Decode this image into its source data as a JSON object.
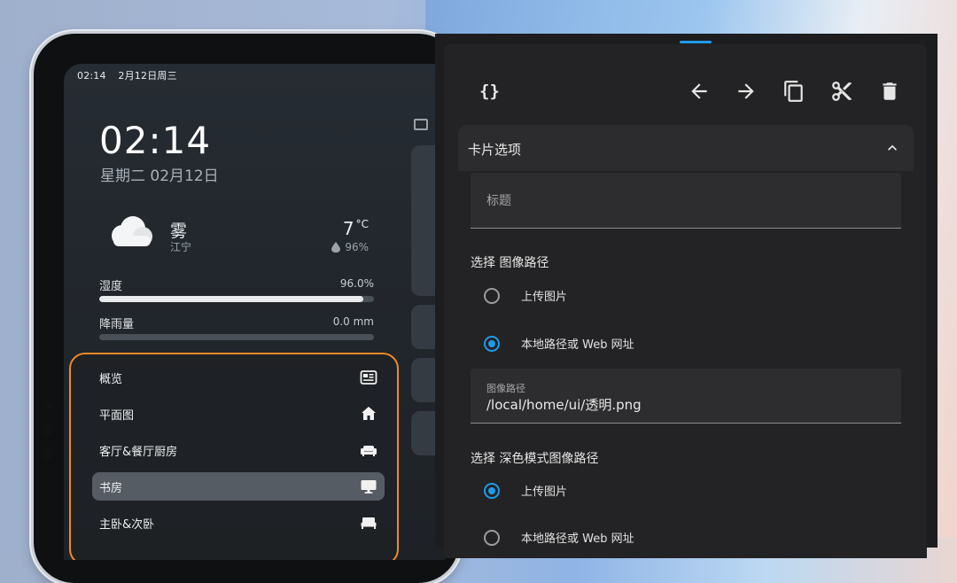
{
  "status_bar": {
    "time": "02:14",
    "date": "2月12日周三"
  },
  "clock": {
    "time": "02:14",
    "date": "星期二 02月12日"
  },
  "weather": {
    "condition": "雾",
    "location": "江宁",
    "temperature": "7",
    "unit": "°C",
    "humidity": "96%"
  },
  "sensors": [
    {
      "label": "湿度",
      "value": "96.0%",
      "fraction": 0.96
    },
    {
      "label": "降雨量",
      "value": "0.0 mm",
      "fraction": 0.0
    }
  ],
  "nav": {
    "items": [
      {
        "label": "概览",
        "icon": "newspaper-icon",
        "active": false
      },
      {
        "label": "平面图",
        "icon": "home-icon",
        "active": false
      },
      {
        "label": "客厅&餐厅厨房",
        "icon": "sofa-icon",
        "active": false
      },
      {
        "label": "书房",
        "icon": "monitor-icon",
        "active": true
      },
      {
        "label": "主卧&次卧",
        "icon": "bed-icon",
        "active": false
      }
    ]
  },
  "editor": {
    "toolbar": {
      "code_icon": "{}",
      "icons": [
        "arrow-left-icon",
        "arrow-right-icon",
        "copy-icon",
        "cut-icon",
        "delete-icon"
      ]
    },
    "section_title": "卡片选项",
    "title_placeholder": "标题",
    "image_path_group": {
      "label": "选择 图像路径",
      "options": [
        {
          "label": "上传图片",
          "checked": false
        },
        {
          "label": "本地路径或 Web 网址",
          "checked": true
        }
      ],
      "field_label": "图像路径",
      "field_value": "/local/home/ui/透明.png"
    },
    "dark_image_group": {
      "label": "选择 深色模式图像路径",
      "options": [
        {
          "label": "上传图片",
          "checked": true
        },
        {
          "label": "本地路径或 Web 网址",
          "checked": false
        }
      ]
    }
  },
  "colors": {
    "accent": "#1e9be8",
    "highlight_border": "#ee8a2a",
    "panel_bg": "#1d1d1f"
  }
}
